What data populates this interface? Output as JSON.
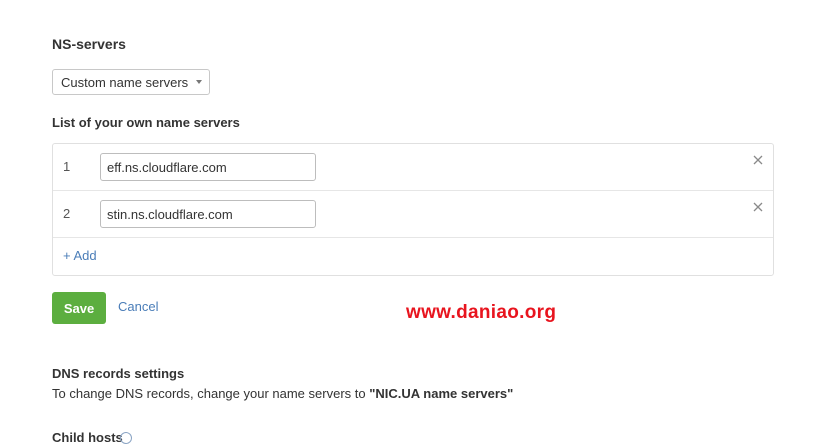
{
  "ns_section": {
    "title": "NS-servers",
    "select_value": "Custom name servers"
  },
  "list": {
    "title": "List of your own name servers",
    "rows": [
      {
        "num": "1",
        "value": "eff.ns.cloudflare.com"
      },
      {
        "num": "2",
        "value": "stin.ns.cloudflare.com"
      }
    ],
    "add_label": "+ Add"
  },
  "actions": {
    "save_label": "Save",
    "cancel_label": "Cancel"
  },
  "watermark": "www.daniao.org",
  "dns": {
    "title": "DNS records settings",
    "desc_prefix": "To change DNS records, change your name servers to ",
    "desc_target": "\"NIC.UA name servers\""
  },
  "partial": {
    "label": "Child hosts"
  },
  "colors": {
    "save_green": "#5cae3f",
    "link_blue": "#4a7db8",
    "watermark_red": "#e8141e"
  },
  "icons": {
    "select_caret": "chevron-down-icon",
    "remove": "close-icon",
    "help": "info-icon"
  }
}
